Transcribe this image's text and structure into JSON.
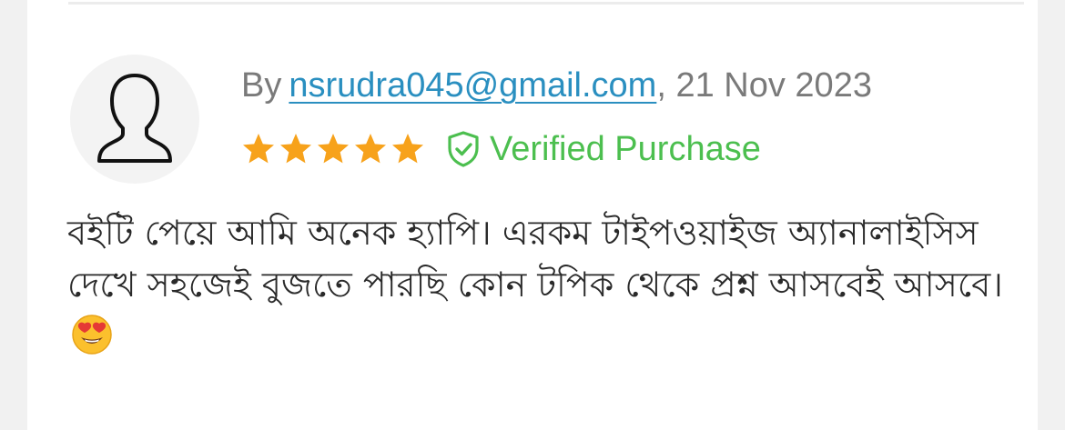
{
  "review": {
    "by_label": "By",
    "author": "nsrudra045@gmail.com",
    "date_sep": ", ",
    "date": "21 Nov 2023",
    "rating": 5,
    "rating_max": 5,
    "verified_label": "Verified Purchase",
    "text": "বইটি পেয়ে আমি অনেক হ্যাপি। এরকম টাইপওয়াইজ অ্যানালাইসিস দেখে সহজেই বুজতে পারছি কোন টপিক থেকে প্রশ্ন আসবেই আসবে।"
  },
  "icons": {
    "avatar": "user-silhouette-icon",
    "star": "star-icon",
    "verified": "shield-check-icon",
    "emoji": "heart-eyes-emoji"
  },
  "colors": {
    "link": "#2a8fc0",
    "star": "#f7a21b",
    "verified": "#4cbf4f",
    "meta_text": "#7a7a7a"
  }
}
